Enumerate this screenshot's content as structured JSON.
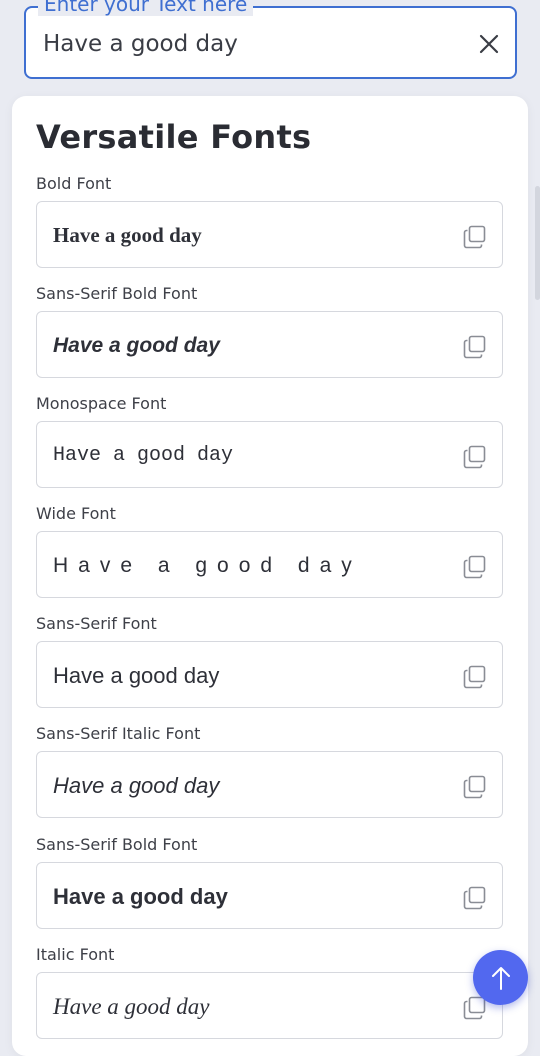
{
  "input": {
    "legend": "Enter your Text here",
    "value": "Have a good day"
  },
  "section_title": "Versatile Fonts",
  "fonts": [
    {
      "label": "Bold Font",
      "sample": "Have a good day"
    },
    {
      "label": "Sans-Serif Bold Font",
      "sample": "Have a good day"
    },
    {
      "label": "Monospace Font",
      "sample": "Have a good day"
    },
    {
      "label": "Wide Font",
      "sample": "Have a good day"
    },
    {
      "label": "Sans-Serif Font",
      "sample": "Have a good day"
    },
    {
      "label": "Sans-Serif Italic Font",
      "sample": "Have a good day"
    },
    {
      "label": "Sans-Serif Bold Font",
      "sample": "Have a good day"
    },
    {
      "label": "Italic Font",
      "sample": "Have a good day"
    }
  ],
  "icons": {
    "clear": "close-icon",
    "copy": "copy-icon",
    "scroll_top": "arrow-up-icon"
  },
  "colors": {
    "accent": "#3f6fd1",
    "fab": "#5268ef",
    "background": "#e9ebf2"
  }
}
